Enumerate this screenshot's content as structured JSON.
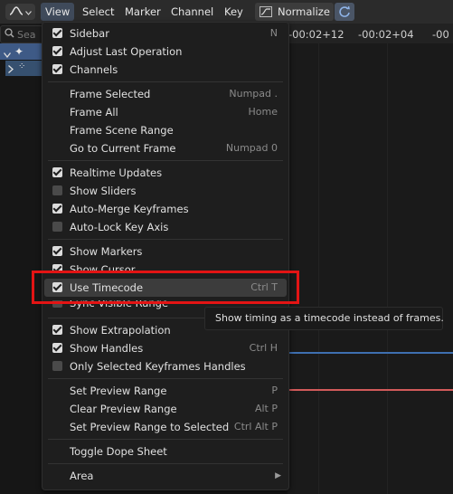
{
  "header": {
    "menus": [
      "View",
      "Select",
      "Marker",
      "Channel",
      "Key"
    ],
    "normalize_label": "Normalize"
  },
  "search": {
    "placeholder": "Sea"
  },
  "timeline": {
    "frames": [
      "-00:02+12",
      "-00:02+04",
      "-00"
    ]
  },
  "menu": {
    "groups": [
      [
        {
          "label": "Sidebar",
          "checked": true,
          "shortcut": "N"
        },
        {
          "label": "Adjust Last Operation",
          "checked": true,
          "shortcut": ""
        },
        {
          "label": "Channels",
          "checked": true,
          "shortcut": ""
        }
      ],
      [
        {
          "label": "Frame Selected",
          "shortcut": "Numpad ."
        },
        {
          "label": "Frame All",
          "shortcut": "Home"
        },
        {
          "label": "Frame Scene Range",
          "shortcut": ""
        },
        {
          "label": "Go to Current Frame",
          "shortcut": "Numpad 0"
        }
      ],
      [
        {
          "label": "Realtime Updates",
          "checked": true,
          "shortcut": ""
        },
        {
          "label": "Show Sliders",
          "checked": false,
          "shortcut": ""
        },
        {
          "label": "Auto-Merge Keyframes",
          "checked": true,
          "shortcut": ""
        },
        {
          "label": "Auto-Lock Key Axis",
          "checked": false,
          "shortcut": ""
        }
      ],
      [
        {
          "label": "Show Markers",
          "checked": true,
          "shortcut": ""
        },
        {
          "label": "Show Cursor",
          "checked": true,
          "shortcut": ""
        },
        {
          "label": "Use Timecode",
          "checked": true,
          "shortcut": "Ctrl T"
        },
        {
          "label": "Sync Visible Range",
          "checked": false,
          "shortcut": ""
        }
      ],
      [
        {
          "label": "Show Extrapolation",
          "checked": true,
          "shortcut": ""
        },
        {
          "label": "Show Handles",
          "checked": true,
          "shortcut": "Ctrl H"
        },
        {
          "label": "Only Selected Keyframes Handles",
          "checked": false,
          "shortcut": ""
        }
      ],
      [
        {
          "label": "Set Preview Range",
          "shortcut": "P"
        },
        {
          "label": "Clear Preview Range",
          "shortcut": "Alt P"
        },
        {
          "label": "Set Preview Range to Selected",
          "shortcut": "Ctrl Alt P"
        }
      ],
      [
        {
          "label": "Toggle Dope Sheet",
          "shortcut": ""
        }
      ],
      [
        {
          "label": "Area",
          "shortcut": "",
          "submenu": true
        }
      ]
    ]
  },
  "tooltip": {
    "text": "Show timing as a timecode instead of frames."
  }
}
